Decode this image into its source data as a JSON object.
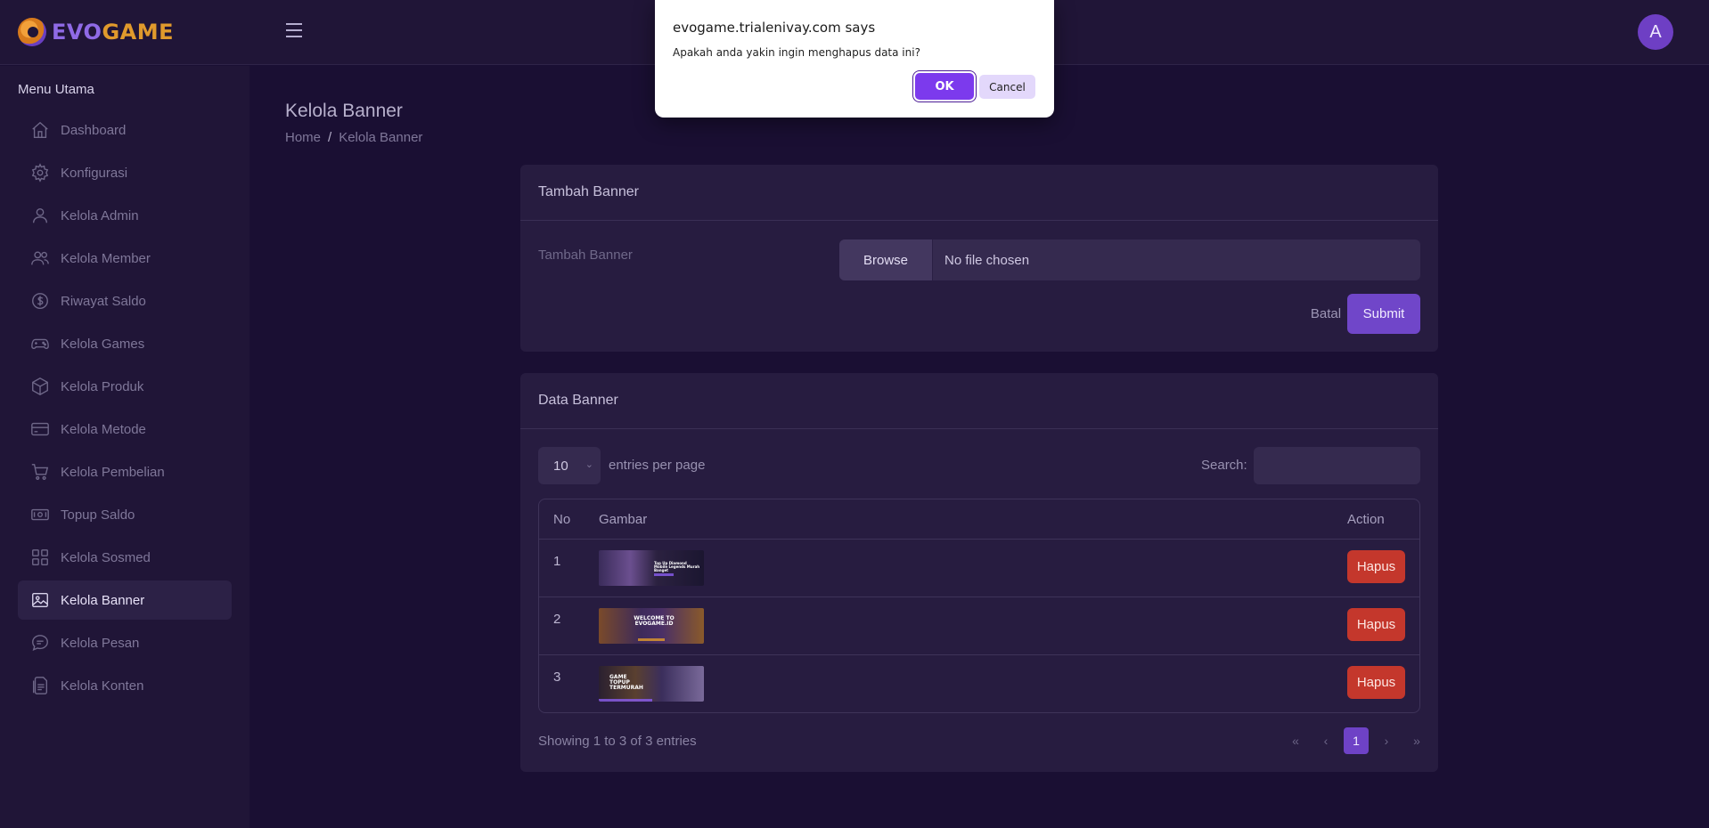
{
  "brand": {
    "name_part1": "EVO",
    "name_part2": "GAME"
  },
  "header": {
    "avatar_initial": "A"
  },
  "sidebar": {
    "heading": "Menu Utama",
    "items": [
      {
        "label": "Dashboard",
        "icon": "home-icon",
        "active": false
      },
      {
        "label": "Konfigurasi",
        "icon": "gear-icon",
        "active": false
      },
      {
        "label": "Kelola Admin",
        "icon": "user-icon",
        "active": false
      },
      {
        "label": "Kelola Member",
        "icon": "users-icon",
        "active": false
      },
      {
        "label": "Riwayat Saldo",
        "icon": "dollar-circle-icon",
        "active": false
      },
      {
        "label": "Kelola Games",
        "icon": "gamepad-icon",
        "active": false
      },
      {
        "label": "Kelola Produk",
        "icon": "box-icon",
        "active": false
      },
      {
        "label": "Kelola Metode",
        "icon": "card-icon",
        "active": false
      },
      {
        "label": "Kelola Pembelian",
        "icon": "cart-icon",
        "active": false
      },
      {
        "label": "Topup Saldo",
        "icon": "cash-icon",
        "active": false
      },
      {
        "label": "Kelola Sosmed",
        "icon": "grid-icon",
        "active": false
      },
      {
        "label": "Kelola Banner",
        "icon": "image-icon",
        "active": true
      },
      {
        "label": "Kelola Pesan",
        "icon": "chat-icon",
        "active": false
      },
      {
        "label": "Kelola Konten",
        "icon": "document-icon",
        "active": false
      }
    ]
  },
  "page": {
    "title": "Kelola Banner",
    "breadcrumb": {
      "home": "Home",
      "separator": "/",
      "current": "Kelola Banner"
    }
  },
  "add_card": {
    "header": "Tambah Banner",
    "field_label": "Tambah Banner",
    "browse_label": "Browse",
    "file_status": "No file chosen",
    "cancel_label": "Batal",
    "submit_label": "Submit"
  },
  "data_card": {
    "header": "Data Banner",
    "entries_value": "10",
    "entries_label": "entries per page",
    "search_label": "Search:",
    "columns": {
      "no": "No",
      "image": "Gambar",
      "action": "Action"
    },
    "rows": [
      {
        "no": "1",
        "action": "Hapus",
        "thumb_text": "Top Up Diamond Mobile Legends Murah Banget"
      },
      {
        "no": "2",
        "action": "Hapus",
        "thumb_text": "WELCOME TO EVOGAME.ID"
      },
      {
        "no": "3",
        "action": "Hapus",
        "thumb_text": "GAME TOPUP TERMURAH"
      }
    ],
    "showing": "Showing 1 to 3 of 3 entries",
    "pager": {
      "first": "«",
      "prev": "‹",
      "current": "1",
      "next": "›",
      "last": "»"
    }
  },
  "dialog": {
    "title": "evogame.trialenivay.com says",
    "message": "Apakah anda yakin ingin menghapus data ini?",
    "ok_label": "OK",
    "cancel_label": "Cancel"
  },
  "colors": {
    "background": "#1a0f33",
    "panel": "#201537",
    "card": "#271c40",
    "accent": "#7046c9",
    "danger": "#c4372c",
    "brand_orange": "#e09a2c"
  }
}
